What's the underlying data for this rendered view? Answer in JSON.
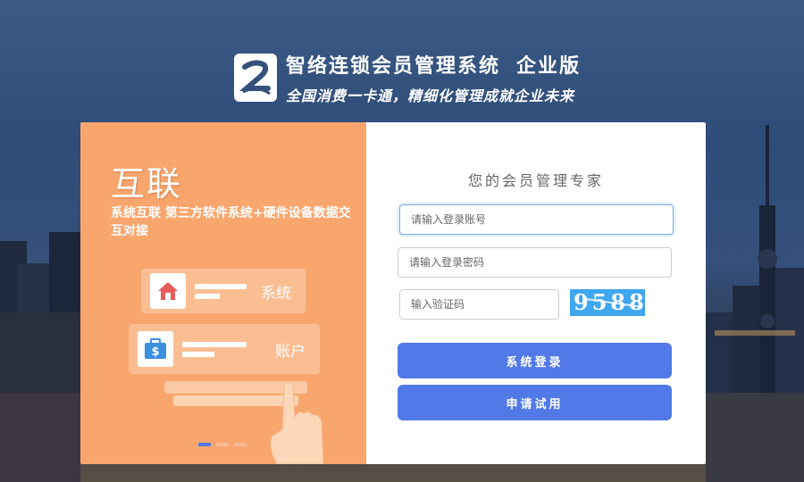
{
  "brand": {
    "title": "智络连锁会员管理系统",
    "edition": "企业版",
    "slogan": "全国消费一卡通，精细化管理成就企业未来"
  },
  "promo": {
    "title": "互联",
    "description": "系统互联  第三方软件系统+硬件设备数据交互对接",
    "card_system_label": "系统",
    "card_account_label": "账户",
    "slides": 3,
    "active_slide": 1
  },
  "login": {
    "heading": "您的会员管理专家",
    "account_placeholder": "请输入登录账号",
    "password_placeholder": "请输入登录密码",
    "captcha_placeholder": "输入验证码",
    "captcha_text": "9588",
    "login_button": "系统登录",
    "trial_button": "申请试用"
  },
  "colors": {
    "accent": "#5179e8",
    "promo_bg": "#f8a66e",
    "captcha_bg": "#3fa6f0"
  }
}
